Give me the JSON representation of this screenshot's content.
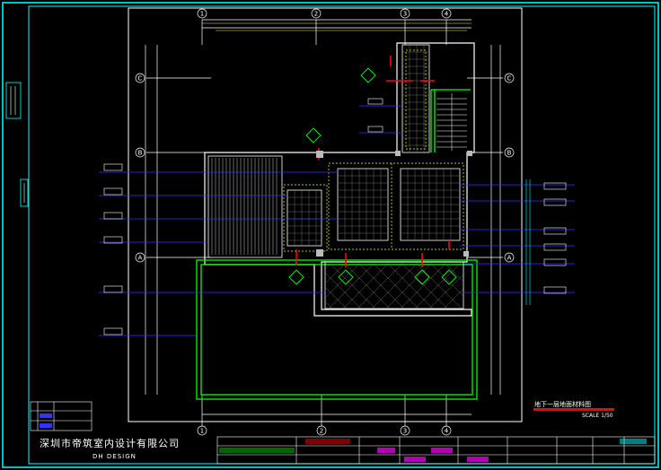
{
  "drawing": {
    "company_name": "深圳市帝筑室内设计有限公司",
    "company_sub": "DH  DESIGN",
    "plan_title": "地下一层地面材料图",
    "scale": "SCALE 1/50",
    "grid_columns": [
      "1",
      "2",
      "3",
      "4"
    ],
    "grid_rows": [
      "C",
      "B",
      "A"
    ],
    "colors": {
      "background": "#000000",
      "frame": "#ffffff",
      "wall": "#00ff00",
      "dimension": "#ffff00",
      "leader": "#0000ff",
      "border": "#00ffff",
      "marker": "#ff0000",
      "highlight": "#ff00ff"
    }
  }
}
